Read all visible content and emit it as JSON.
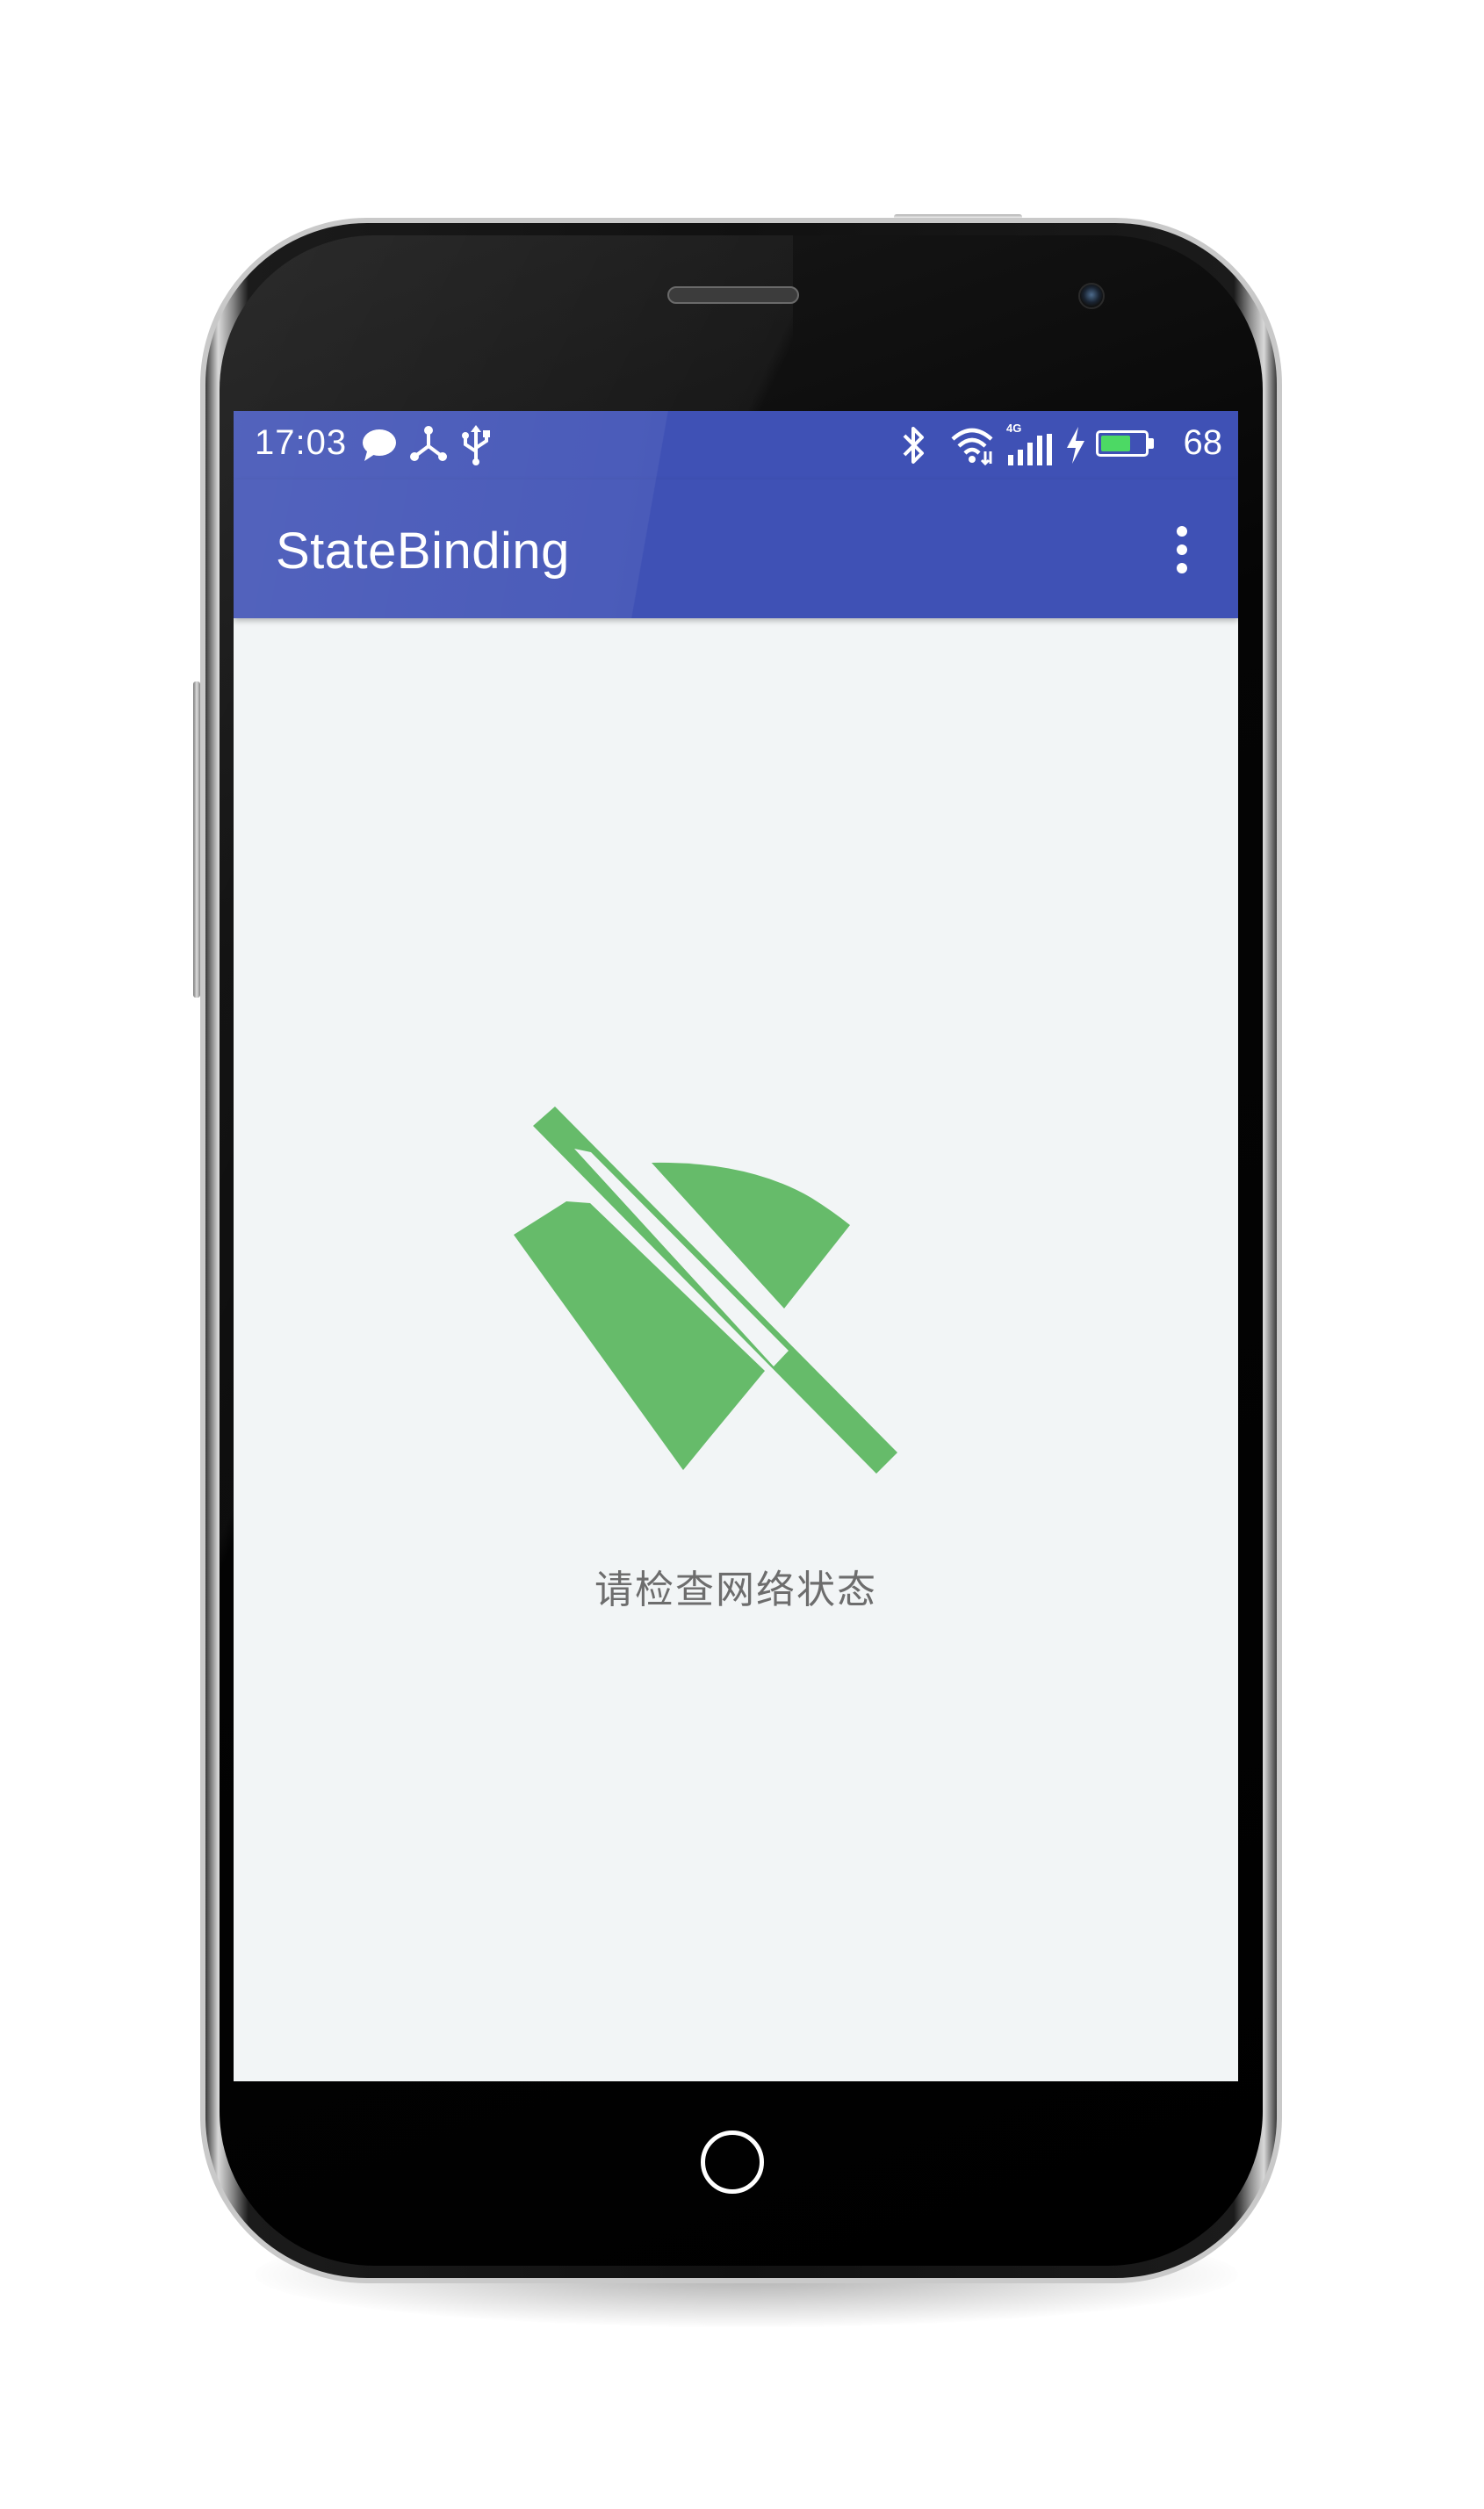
{
  "device": {
    "frame_color": "#111111",
    "bezel_highlight": "#d8d8d8"
  },
  "status_bar": {
    "time": "17:03",
    "network_type": "4G",
    "battery_percent": "68",
    "left_icons": [
      "message-bubble-icon",
      "share-node-icon",
      "usb-icon"
    ],
    "right_icons": [
      "bluetooth-icon",
      "wifi-icon",
      "signal-4g-icon",
      "charging-bolt-icon",
      "battery-icon"
    ],
    "battery_level": 0.68,
    "battery_color": "#4cd964"
  },
  "app_bar": {
    "title": "StateBinding",
    "overflow_icon": "more-vert-icon",
    "color": "#3f51b5"
  },
  "content": {
    "background": "#f2f5f6",
    "state_icon": "wifi-off-icon",
    "state_icon_color": "#66bb6a",
    "message": "请检查网络状态"
  },
  "nav": {
    "home_icon": "home-circle-icon"
  }
}
